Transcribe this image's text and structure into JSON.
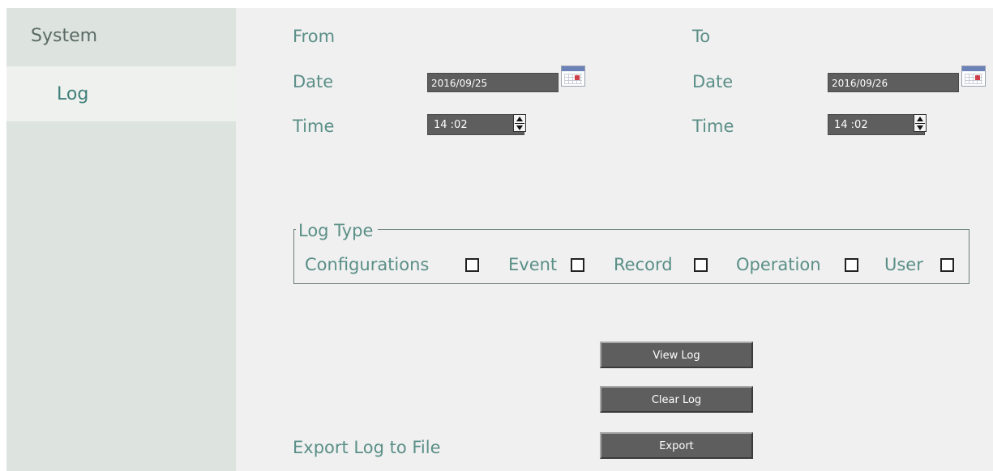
{
  "sidebar": {
    "heading": "System",
    "items": [
      {
        "label": "Log"
      }
    ]
  },
  "from": {
    "heading": "From",
    "date_label": "Date",
    "date_value": "2016/09/25",
    "time_label": "Time",
    "time_value": "14 :02"
  },
  "to": {
    "heading": "To",
    "date_label": "Date",
    "date_value": "2016/09/26",
    "time_label": "Time",
    "time_value": "14 :02"
  },
  "log_type": {
    "legend": "Log Type",
    "options": [
      {
        "label": "Configurations",
        "checked": false
      },
      {
        "label": "Event",
        "checked": false
      },
      {
        "label": "Record",
        "checked": false
      },
      {
        "label": "Operation",
        "checked": false
      },
      {
        "label": "User",
        "checked": false
      }
    ]
  },
  "actions": {
    "view_label": "View Log",
    "clear_label": "Clear Log",
    "export_text": "Export Log to File",
    "export_label": "Export"
  },
  "colors": {
    "sidebar_bg": "#dde3de",
    "main_bg": "#f0f0f0",
    "accent_text": "#5a8f87",
    "control_bg": "#5e5e5e"
  },
  "icons": {
    "calendar": "calendar-icon",
    "spinner": "spinner-icon"
  }
}
